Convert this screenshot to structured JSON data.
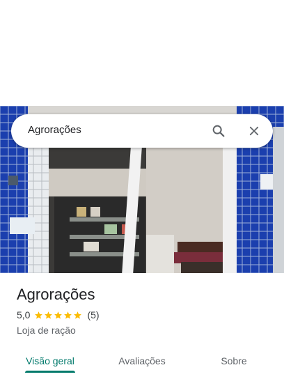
{
  "search": {
    "value": "Agrorações"
  },
  "icons": {
    "search": "search-icon",
    "close": "close-icon",
    "star": "star-icon"
  },
  "place": {
    "title": "Agrorações",
    "rating": "5,0",
    "stars": 5,
    "review_count": "(5)",
    "category": "Loja de ração"
  },
  "tabs": [
    {
      "label": "Visão geral",
      "active": true
    },
    {
      "label": "Avaliações",
      "active": false
    },
    {
      "label": "Sobre",
      "active": false
    }
  ],
  "colors": {
    "accent": "#00796b",
    "star": "#fbbc04",
    "tile_blue": "#1a3fb0"
  }
}
